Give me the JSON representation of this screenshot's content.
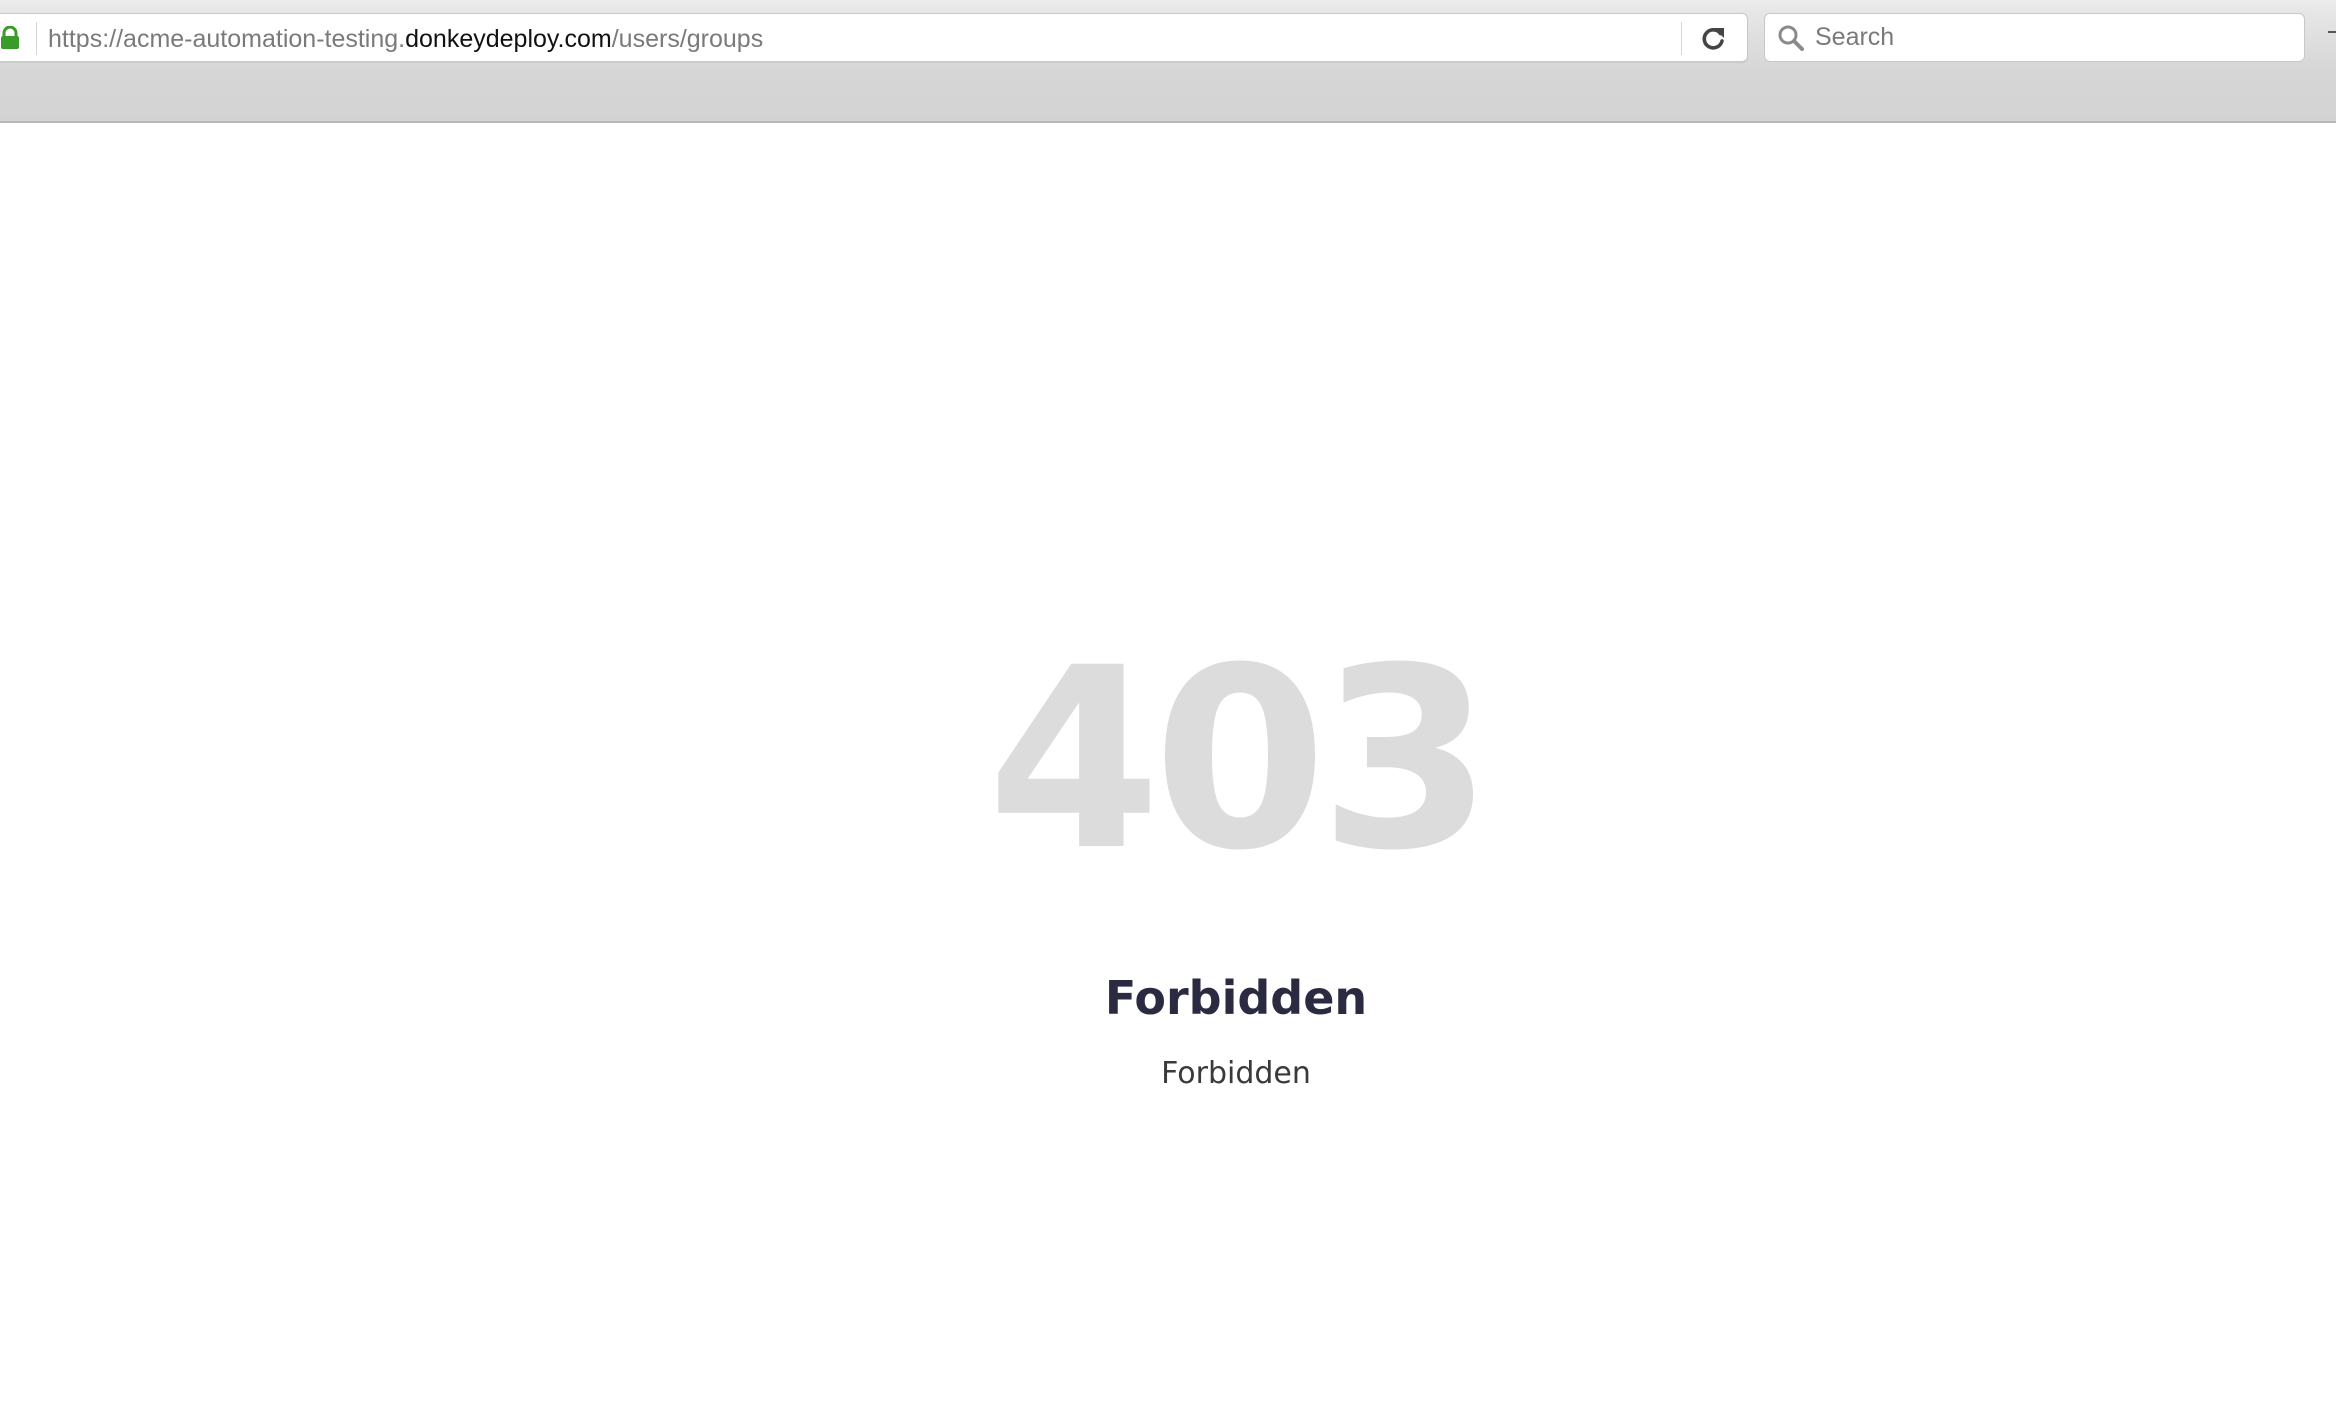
{
  "browser": {
    "url": {
      "prefix": "https://acme-automation-testing.",
      "domain": "donkeydeploy.com",
      "path": "/users/groups"
    },
    "search": {
      "placeholder": "Search",
      "value": ""
    },
    "icons": {
      "lock": "lock-icon",
      "reload": "reload-icon",
      "search": "search-icon"
    },
    "colors": {
      "lock": "#3a9a2a"
    }
  },
  "error_page": {
    "code": "403",
    "title": "Forbidden",
    "message": "Forbidden"
  }
}
